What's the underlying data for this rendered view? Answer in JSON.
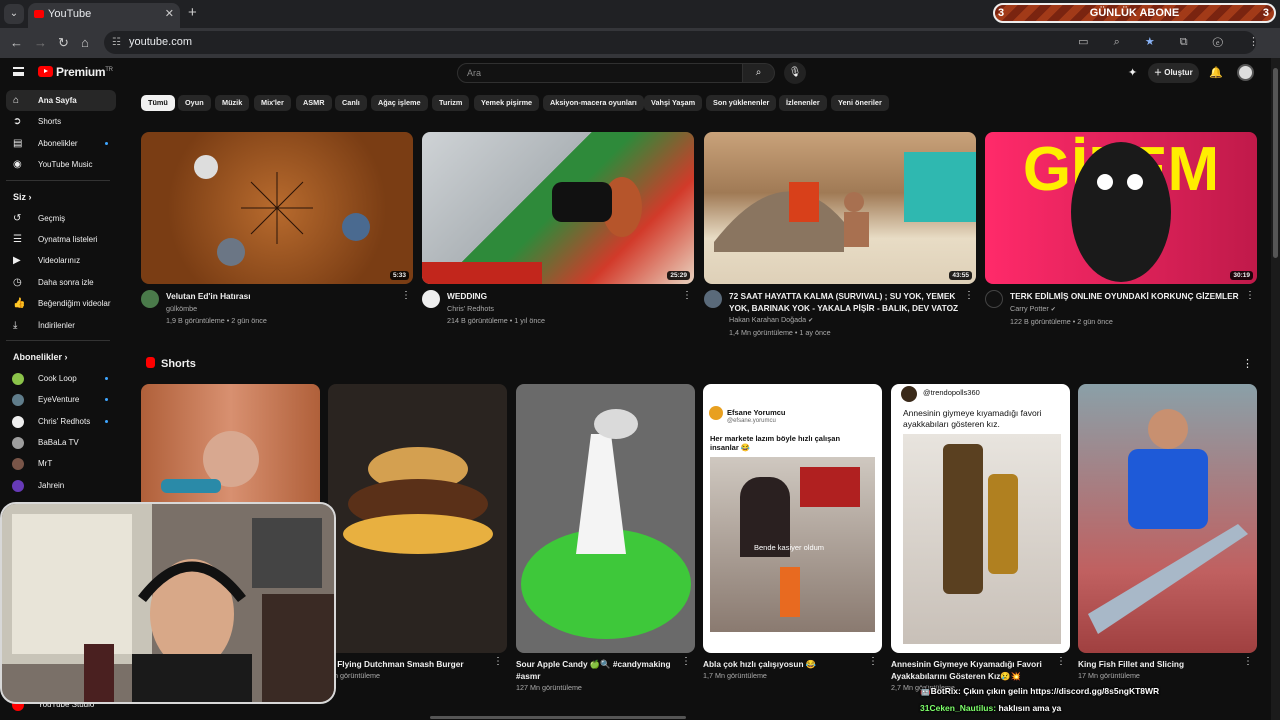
{
  "browser": {
    "tab_title": "YouTube",
    "url": "youtube.com",
    "ticker": {
      "label": "GÜNLÜK ABONE",
      "left_count": "3",
      "right_count": "3"
    }
  },
  "masthead": {
    "logo_text": "Premium",
    "logo_suffix": "TR",
    "search_placeholder": "Ara",
    "create_label": "Oluştur"
  },
  "sidebar": {
    "main": [
      {
        "label": "Ana Sayfa",
        "icon": "home-icon"
      },
      {
        "label": "Shorts",
        "icon": "shorts-icon"
      },
      {
        "label": "Abonelikler",
        "icon": "subscriptions-icon"
      },
      {
        "label": "YouTube Music",
        "icon": "music-icon"
      }
    ],
    "you_header": "Siz",
    "you": [
      {
        "label": "Geçmiş"
      },
      {
        "label": "Oynatma listeleri"
      },
      {
        "label": "Videolarınız"
      },
      {
        "label": "Daha sonra izle"
      },
      {
        "label": "Beğendiğim videolar"
      },
      {
        "label": "İndirilenler"
      }
    ],
    "subs_header": "Abonelikler",
    "subs": [
      {
        "label": "Cook Loop",
        "color": "#8bc34a"
      },
      {
        "label": "EyeVenture",
        "color": "#607d8b"
      },
      {
        "label": "Chris' Redhots",
        "color": "#eeeeee"
      },
      {
        "label": "BaBaLa TV",
        "color": "#9e9e9e"
      },
      {
        "label": "MrT",
        "color": "#795548"
      },
      {
        "label": "Jahrein",
        "color": "#673ab7"
      }
    ],
    "studio_label": "YouTube Studio"
  },
  "chips": [
    "Tümü",
    "Oyun",
    "Müzik",
    "Mix'ler",
    "ASMR",
    "Canlı",
    "Ağaç işleme",
    "Turizm",
    "Yemek pişirme",
    "Aksiyon-macera oyunları",
    "Vahşi Yaşam",
    "Son yüklenenler",
    "İzlenenler",
    "Yeni öneriler"
  ],
  "videos": [
    {
      "title": "Velutan Ed'in Hatırası",
      "channel": "gülkömbe",
      "stats": "1,9 B görüntüleme • 2 gün önce",
      "duration": "5:33"
    },
    {
      "title": "WEDDING",
      "channel": "Chris' Redhots",
      "stats": "214 B görüntüleme • 1 yıl önce",
      "duration": "25:29"
    },
    {
      "title": "72 SAAT HAYATTA KALMA (SURVIVAL) ; SU YOK, YEMEK YOK, BARINAK YOK - YAKALA PİŞİR - BALIK, DEV VATOZ",
      "channel": "Hakan Karahan Doğada",
      "stats": "1,4 Mn görüntüleme • 1 ay önce",
      "duration": "43:55"
    },
    {
      "title": "TERK EDİLMİŞ ONLINE OYUNDAKİ KORKUNÇ GİZEMLER",
      "channel": "Carry Potter",
      "stats": "122 B görüntüleme • 2 gün önce",
      "duration": "30:19",
      "thumb_text": "GİZEM"
    }
  ],
  "shorts_header": "Shorts",
  "shorts": [
    {
      "title": "",
      "views": ""
    },
    {
      "title": "al Flying Dutchman Smash Burger",
      "views": "Mn görüntüleme"
    },
    {
      "title": "Sour Apple Candy 🍏🔍 #candymaking #asmr",
      "views": "127 Mn görüntüleme"
    },
    {
      "title": "Abla çok hızlı çalışıyosun 😂",
      "views": "1,7 Mn görüntüleme",
      "overlay_name": "Efsane Yorumcu",
      "overlay_handle": "@efsane.yorumcu",
      "overlay_text": "Her markete lazım böyle hızlı çalışan insanlar 😂",
      "overlay_sub": "Bende kasiyer oldum"
    },
    {
      "title": "Annesinin Giymeye Kıyamadığı Favori Ayakkabılarını Gösteren Kız😢💥",
      "views": "2,7 Mn görüntüleme",
      "overlay_handle": "@trendopolls360",
      "overlay_text": "Annesinin giymeye kıyamadığı favori ayakkabıları gösteren kız."
    },
    {
      "title": "King Fish Fillet and Slicing",
      "views": "17 Mn görüntüleme"
    }
  ],
  "chat": [
    {
      "user": "🤖BotRix:",
      "text": "Çıkın çıkın gelin https://discord.gg/8s5ngKT8WR"
    },
    {
      "user": "31Ceken_Nautilus:",
      "text": "haklısın ama ya"
    }
  ],
  "colors": {
    "accent": "#ff0000",
    "link": "#3ea6ff",
    "bg": "#0f0f0f"
  }
}
